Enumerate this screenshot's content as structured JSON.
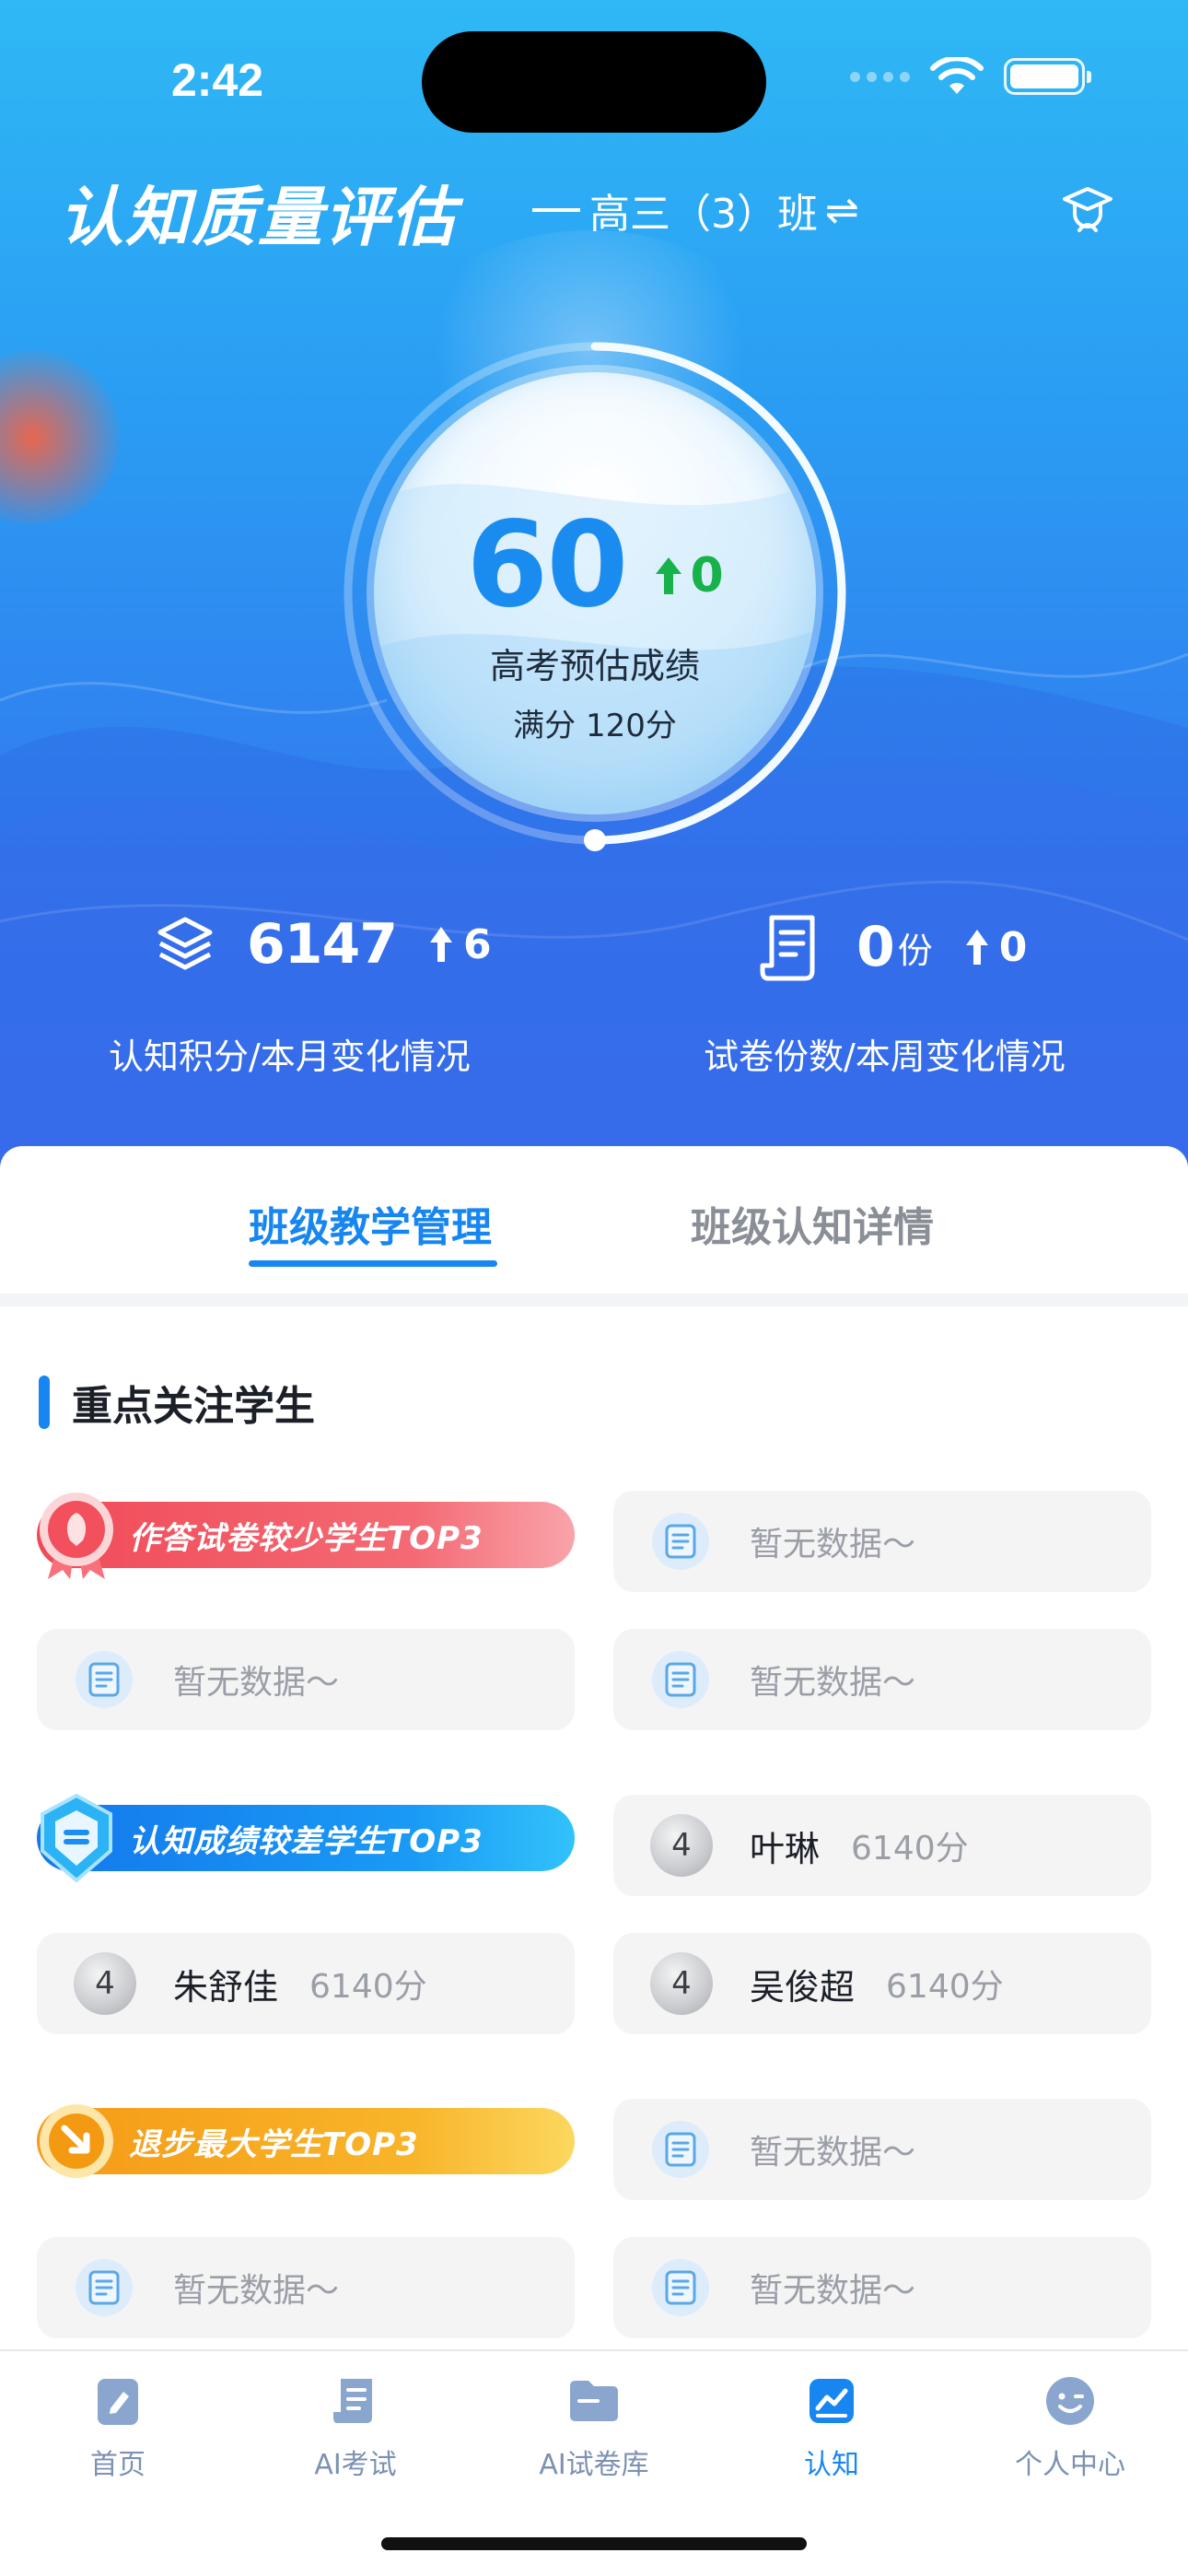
{
  "status_bar": {
    "time": "2:42"
  },
  "header": {
    "title": "认知质量评估",
    "class_name": "高三（3）班",
    "switch_symbol": "⇌"
  },
  "gauge": {
    "score": "60",
    "score_change": "0",
    "label": "高考预估成绩",
    "full_score": "满分 120分",
    "progress_fraction": 0.5
  },
  "stats": {
    "points": {
      "value": "6147",
      "change": "6",
      "label": "认知积分/本月变化情况"
    },
    "papers": {
      "value": "0",
      "unit": "份",
      "change": "0",
      "label": "试卷份数/本周变化情况"
    }
  },
  "tabs": [
    {
      "label": "班级教学管理",
      "active": true
    },
    {
      "label": "班级认知详情",
      "active": false
    }
  ],
  "focus_section": {
    "title": "重点关注学生",
    "groups": [
      {
        "banner": "作答试卷较少学生TOP3",
        "color": "#f04a57",
        "items": [
          {
            "empty": "暂无数据～"
          },
          {
            "empty": "暂无数据～"
          },
          {
            "empty": "暂无数据～"
          }
        ]
      },
      {
        "banner": "认知成绩较差学生TOP3",
        "color": "#1a8ef5",
        "items": [
          {
            "rank": "4",
            "name": "叶琳",
            "points": "6140分"
          },
          {
            "rank": "4",
            "name": "朱舒佳",
            "points": "6140分"
          },
          {
            "rank": "4",
            "name": "吴俊超",
            "points": "6140分"
          }
        ]
      },
      {
        "banner": "退步最大学生TOP3",
        "color": "#f7a21b",
        "items": [
          {
            "empty": "暂无数据～"
          },
          {
            "empty": "暂无数据～"
          },
          {
            "empty": "暂无数据～"
          }
        ]
      }
    ]
  },
  "tabbar": [
    {
      "label": "首页",
      "icon": "pen-doc-icon",
      "active": false
    },
    {
      "label": "AI考试",
      "icon": "scroll-icon",
      "active": false
    },
    {
      "label": "AI试卷库",
      "icon": "folder-icon",
      "active": false
    },
    {
      "label": "认知",
      "icon": "chart-icon",
      "active": true
    },
    {
      "label": "个人中心",
      "icon": "face-icon",
      "active": false
    }
  ]
}
